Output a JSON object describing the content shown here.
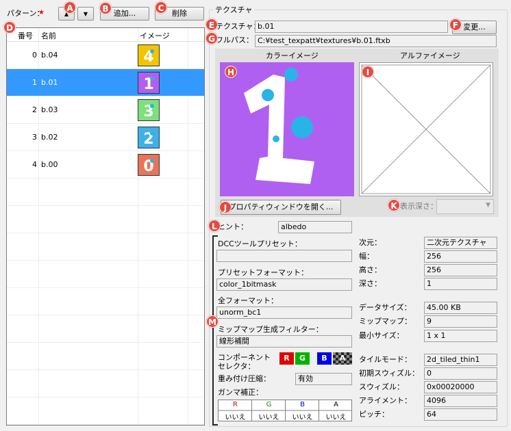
{
  "pattern_label": "パターン：",
  "required_mark": "★",
  "add_label": "追加...",
  "delete_label": "削除",
  "list": {
    "columns": [
      "番号",
      "名前",
      "イメージ"
    ],
    "rows": [
      {
        "num": "0",
        "name": "b.04",
        "color": "#f3c400",
        "glyph": "4"
      },
      {
        "num": "1",
        "name": "b.01",
        "color": "#b060f0",
        "glyph": "1"
      },
      {
        "num": "2",
        "name": "b.03",
        "color": "#7de07d",
        "glyph": "3"
      },
      {
        "num": "3",
        "name": "b.02",
        "color": "#3fb0e8",
        "glyph": "2"
      },
      {
        "num": "4",
        "name": "b.00",
        "color": "#e8745a",
        "glyph": "0"
      }
    ]
  },
  "texture": {
    "group_title": "テクスチャ",
    "texture_label": "テクスチャ：",
    "texture_value": "b.01",
    "change_label": "変更...",
    "fullpath_label": "フルパス：",
    "fullpath_value": "C:¥test_texpatt¥textures¥b.01.ftxb",
    "color_image_label": "カラーイメージ",
    "alpha_image_label": "アルファイメージ",
    "open_property_label": "プロパティウィンドウを開く...",
    "display_depth_label": "表示深さ：",
    "hint_label": "ヒント：",
    "hint_value": "albedo"
  },
  "details": {
    "dcc_preset_label": "DCCツールプリセット：",
    "dcc_preset_value": "",
    "preset_format_label": "プリセットフォーマット：",
    "preset_format_value": "color_1bitmask",
    "full_format_label": "全フォーマット：",
    "full_format_value": "unorm_bc1",
    "mip_filter_label": "ミップマップ生成フィルター：",
    "mip_filter_value": "線形補間",
    "component_selector_label": "コンポーネント\nセレクタ：",
    "components": [
      "R",
      "G",
      "B",
      "A"
    ],
    "weighted_label": "重み付け圧縮：",
    "weighted_value": "有効",
    "gamma_label": "ガンマ補正：",
    "gamma_headers": [
      "R",
      "G",
      "B",
      "A"
    ],
    "gamma_values": [
      "いいえ",
      "いいえ",
      "いいえ",
      "いいえ"
    ],
    "dimension_label": "次元：",
    "dimension_value": "二次元テクスチャ",
    "width_label": "幅：",
    "width_value": "256",
    "height_label": "高さ：",
    "height_value": "256",
    "depth_label": "深さ：",
    "depth_value": "1",
    "data_size_label": "データサイズ：",
    "data_size_value": "45.00 KB",
    "mipmap_label": "ミップマップ：",
    "mipmap_value": "9",
    "min_size_label": "最小サイズ：",
    "min_size_value": "1 x 1",
    "tile_mode_label": "タイルモード：",
    "tile_mode_value": "2d_tiled_thin1",
    "init_swizzle_label": "初期スウィズル：",
    "init_swizzle_value": "0",
    "swizzle_label": "スウィズル：",
    "swizzle_value": "0x00020000",
    "alignment_label": "アライメント：",
    "alignment_value": "4096",
    "pitch_label": "ピッチ：",
    "pitch_value": "64"
  },
  "badges": [
    "A",
    "B",
    "C",
    "D",
    "E",
    "F",
    "G",
    "H",
    "I",
    "J",
    "K",
    "L",
    "M"
  ],
  "colors": {
    "selection": "#3399ff",
    "badge": "#e24b40",
    "preview_bg": "#b060f0"
  }
}
